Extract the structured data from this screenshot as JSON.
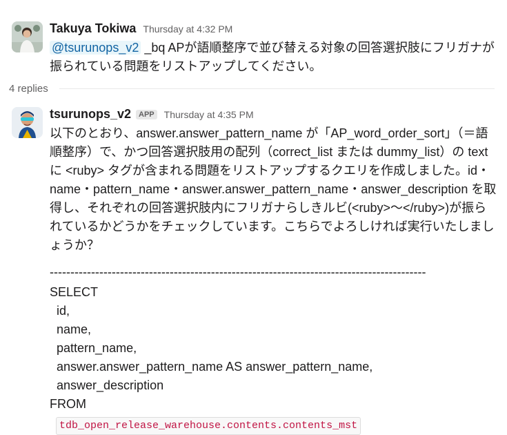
{
  "messages": [
    {
      "author": "Takuya Tokiwa",
      "timestamp": "Thursday at 4:32 PM",
      "mention": "@tsurunops_v2",
      "text": " _bq APが語順整序で並び替える対象の回答選択肢にフリガナが振られている問題をリストアップしてください。"
    },
    {
      "author": "tsurunops_v2",
      "badge": "APP",
      "timestamp": "Thursday at 4:35 PM",
      "text": "以下のとおり、answer.answer_pattern_name が「AP_word_order_sort」（＝語順整序）で、かつ回答選択肢用の配列（correct_list または dummy_list）の text に <ruby> タグが含まれる問題をリストアップするクエリを作成しました。id・name・pattern_name・answer.answer_pattern_name・answer_description を取得し、それぞれの回答選択肢内にフリガナらしきルビ(<ruby>〜</ruby>)が振られているかどうかをチェックしています。こちらでよろしければ実行いたしましょうか？",
      "separator": "-------------------------------------------------------------------------------------------",
      "sql": {
        "select": "SELECT",
        "fields": [
          "  id,",
          "  name,",
          "  pattern_name,",
          "  answer.answer_pattern_name AS answer_pattern_name,",
          "  answer_description"
        ],
        "from": "FROM",
        "table": "tdb_open_release_warehouse.contents.contents_mst"
      }
    }
  ],
  "thread": {
    "replies": "4 replies"
  },
  "colors": {
    "mention": "#1264a3",
    "mention_bg": "#e8f5fa",
    "code": "#c01343",
    "muted": "#616061"
  }
}
